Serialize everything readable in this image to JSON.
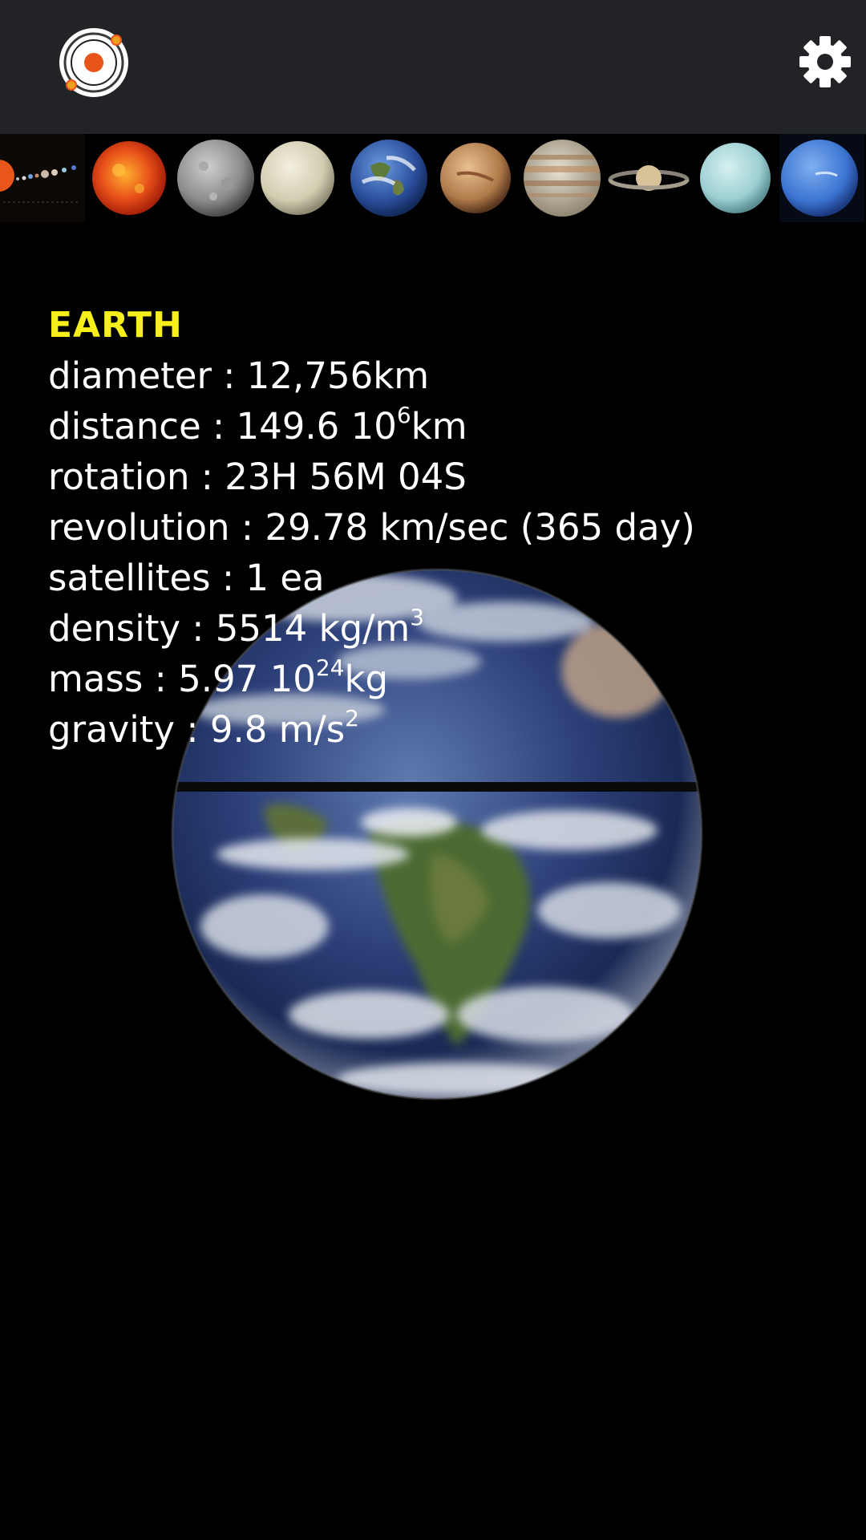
{
  "header": {
    "logo_icon": "orbit-logo-icon",
    "settings_icon": "gear-icon"
  },
  "planet_strip": [
    {
      "name": "solar-system",
      "icon": "solar-system-thumb"
    },
    {
      "name": "sun",
      "icon": "sun-thumb"
    },
    {
      "name": "mercury",
      "icon": "mercury-thumb"
    },
    {
      "name": "venus",
      "icon": "venus-thumb"
    },
    {
      "name": "earth",
      "icon": "earth-thumb"
    },
    {
      "name": "mars",
      "icon": "mars-thumb"
    },
    {
      "name": "jupiter",
      "icon": "jupiter-thumb"
    },
    {
      "name": "saturn",
      "icon": "saturn-thumb"
    },
    {
      "name": "uranus",
      "icon": "uranus-thumb"
    },
    {
      "name": "neptune",
      "icon": "neptune-thumb"
    }
  ],
  "planet": {
    "name": "EARTH",
    "diameter": {
      "label": "diameter : ",
      "value": "12,756km"
    },
    "distance": {
      "label": "distance : ",
      "value": "149.6 10",
      "exp": "6",
      "unit": "km"
    },
    "rotation": {
      "label": "rotation : ",
      "value": "23H 56M 04S"
    },
    "revolution": {
      "label": "revolution : ",
      "value": "29.78 km/sec (365 day)"
    },
    "satellites": {
      "label": "satellites : ",
      "value": "1 ea"
    },
    "density": {
      "label": "density : ",
      "value": "5514 kg/m",
      "exp": "3"
    },
    "mass": {
      "label": "mass : ",
      "value": "5.97 10",
      "exp": "24",
      "unit": "kg"
    },
    "gravity": {
      "label": "gravity : ",
      "value": "9.8 m/s",
      "exp": "2"
    }
  },
  "colors": {
    "topbar": "#222326",
    "planet_name": "#f6ef1c",
    "logo_accent": "#e8541a"
  }
}
